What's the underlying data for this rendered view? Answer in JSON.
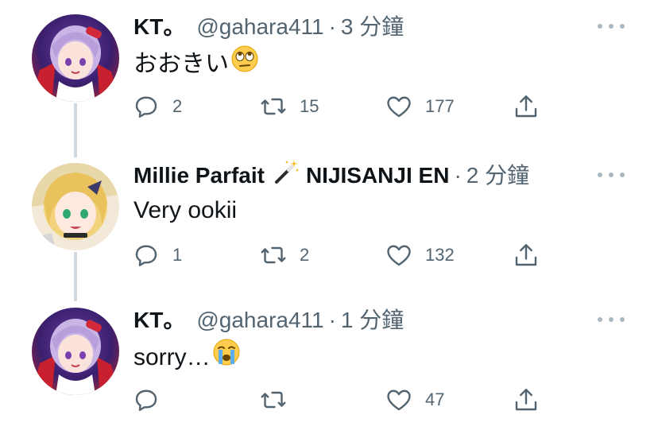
{
  "tweets": [
    {
      "display_name": "KT。",
      "handle": "@gahara411",
      "separator": "·",
      "time": "3 分鐘",
      "text": "おおきい",
      "emoji": "eye-roll-emoji",
      "replies": "2",
      "retweets": "15",
      "likes": "177"
    },
    {
      "display_name": "Millie Parfait",
      "name_emoji": "magic-wand-emoji",
      "name_suffix": "NIJISANJI EN",
      "separator": "·",
      "time": "2 分鐘",
      "text": "Very ookii",
      "replies": "1",
      "retweets": "2",
      "likes": "132"
    },
    {
      "display_name": "KT。",
      "handle": "@gahara411",
      "separator": "·",
      "time": "1 分鐘",
      "text": "sorry…",
      "emoji": "loudly-crying-emoji",
      "replies": "",
      "retweets": "",
      "likes": "47"
    }
  ],
  "colors": {
    "text_primary": "#0f1419",
    "text_secondary": "#536471",
    "thread_line": "#cfd9de"
  }
}
